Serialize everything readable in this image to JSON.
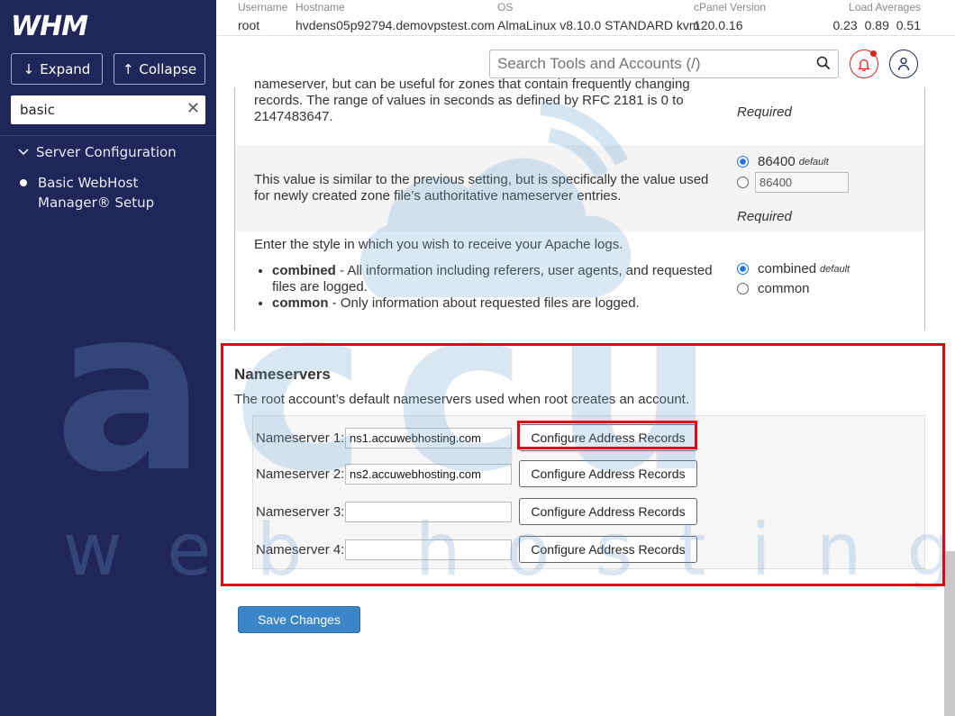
{
  "sidebar": {
    "logo": "WHM",
    "expand_label": "Expand",
    "collapse_label": "Collapse",
    "search_value": "basic",
    "category": "Server Configuration",
    "item": "Basic WebHost Manager® Setup"
  },
  "topbar": {
    "username_label": "Username",
    "username": "root",
    "hostname_label": "Hostname",
    "hostname": "hvdens05p92794.demovpstest.com",
    "os_label": "OS",
    "os": "AlmaLinux v8.10.0 STANDARD kvm",
    "cpanel_label": "cPanel Version",
    "cpanel": "120.0.16",
    "load_label": "Load Averages",
    "load": [
      "0.23",
      "0.89",
      "0.51"
    ]
  },
  "toolbar": {
    "search_placeholder": "Search Tools and Accounts (/)"
  },
  "settings": {
    "row1_desc": "nameserver, but can be useful for zones that contain frequently changing records. The range of values in seconds as defined by RFC 2181 is 0 to 2147483647.",
    "row1_required": "Required",
    "row2_desc": "This value is similar to the previous setting, but is specifically the value used for newly created zone file’s authoritative nameserver entries.",
    "row2_default_value": "86400",
    "row2_default_label": "default",
    "row2_input_value": "86400",
    "row2_required": "Required",
    "row3_desc": "Enter the style in which you wish to receive your Apache logs.",
    "row3_items": [
      {
        "term": "combined",
        "text": " - All information including referers, user agents, and requested files are logged."
      },
      {
        "term": "common",
        "text": " - Only information about requested files are logged."
      }
    ],
    "row3_opt1": "combined",
    "row3_opt1_default": "default",
    "row3_opt2": "common"
  },
  "nameservers": {
    "title": "Nameservers",
    "description": "The root account’s default nameservers used when root creates an account.",
    "rows": [
      {
        "label": "Nameserver 1:",
        "value": "ns1.accuwebhosting.com",
        "button": "Configure Address Records"
      },
      {
        "label": "Nameserver 2:",
        "value": "ns2.accuwebhosting.com",
        "button": "Configure Address Records"
      },
      {
        "label": "Nameserver 3:",
        "value": "",
        "button": "Configure Address Records"
      },
      {
        "label": "Nameserver 4:",
        "value": "",
        "button": "Configure Address Records"
      }
    ]
  },
  "save_label": "Save Changes",
  "watermark": {
    "brand": "accu",
    "tagline": "web hosting"
  },
  "colors": {
    "sidebar_bg": "#20265a",
    "highlight": "#e30613",
    "primary_button": "#3b86c8",
    "watermark": "#a9c8e4"
  }
}
